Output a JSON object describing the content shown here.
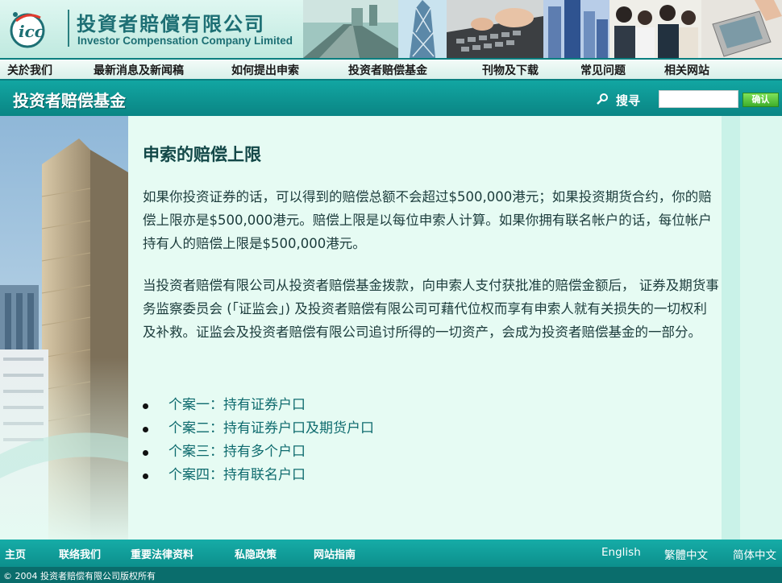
{
  "header": {
    "logo_mark": "icc",
    "logo_cn": "投資者賠償有限公司",
    "logo_en": "Investor Compensation Company Limited"
  },
  "nav": {
    "items": [
      "关於我们",
      "最新消息及新闻稿",
      "如何提出申索",
      "投资者赔偿基金",
      "刊物及下载",
      "常见问题",
      "相关网站"
    ]
  },
  "section": {
    "title": "投资者赔偿基金",
    "search_icon": "magnifier-icon",
    "search_label": "搜寻",
    "search_value": "",
    "search_button": "确认"
  },
  "content": {
    "title": "申索的赔偿上限",
    "paragraphs": [
      "如果你投资证券的话，可以得到的赔偿总额不会超过$500,000港元；如果投资期货合约，你的赔偿上限亦是$500,000港元。赔偿上限是以每位申索人计算。如果你拥有联名帐户的话，每位帐户持有人的赔偿上限是$500,000港元。",
      "当投资者赔偿有限公司从投资者赔偿基金拨款，向申索人支付获批准的赔偿金额后， 证券及期货事务监察委员会 (「证监会」) 及投资者赔偿有限公司可藉代位权而享有申索人就有关损失的一切权利及补救。证监会及投资者赔偿有限公司追讨所得的一切资产，会成为投资者赔偿基金的一部分。"
    ],
    "cases": [
      "个案一：持有证券户口",
      "个案二：持有证券户口及期货户口",
      "个案三：持有多个户口",
      "个案四：持有联名户口"
    ]
  },
  "footer": {
    "links": [
      "主页",
      "联络我们",
      "重要法律资料",
      "私隐政策",
      "网站指南"
    ],
    "languages": [
      "English",
      "繁體中文",
      "简体中文"
    ],
    "copyright": "© 2004 投资者赔偿有限公司版权所有"
  },
  "colors": {
    "teal_dark": "#0a8584",
    "teal_light": "#12a6a2",
    "content_bg": "#e6fbf3",
    "link": "#0e6b6e",
    "button_green": "#3fae2a"
  }
}
